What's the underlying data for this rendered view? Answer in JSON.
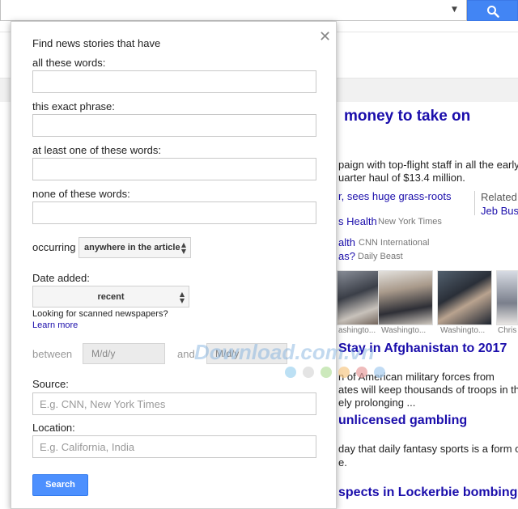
{
  "topbar": {
    "search_value": "",
    "search_icon": "search-icon",
    "dropdown_icon": "caret-down-icon",
    "accent": "#4285f4"
  },
  "panel": {
    "heading": "Find news stories that have",
    "close_icon": "close-icon",
    "all_words_label": "all these words:",
    "exact_phrase_label": "this exact phrase:",
    "at_least_one_label": "at least one of these words:",
    "none_label": "none of these words:",
    "occurring_label": "occurring",
    "occurring_value": "anywhere in the article",
    "date_added_label": "Date added:",
    "date_added_value": "recent",
    "scanned_text": "Looking for scanned newspapers?",
    "learn_more": "Learn more",
    "between_label": "between",
    "and_label": "and",
    "date_from_placeholder": "M/d/y",
    "date_to_placeholder": "M/d/y",
    "source_label": "Source:",
    "source_placeholder": "E.g. CNN, New York Times",
    "location_label": "Location:",
    "location_placeholder": "E.g. California, India",
    "search_button": "Search"
  },
  "news": {
    "headline1": "money to take on",
    "snippet1_line1": "paign with top-flight staff in all the early",
    "snippet1_line2": "uarter haul of $13.4 million.",
    "link1": "r, sees huge grass-roots",
    "related_label": "Related",
    "related_link": "Jeb Bus",
    "link2": "s Health",
    "link2_source": "New York Times",
    "link3": "alth",
    "link3_source": "CNN International",
    "link4": "as?",
    "link4_source": "Daily Beast",
    "captions": [
      "ashingto...",
      "Washingto...",
      "Washingto...",
      "Chris"
    ],
    "headline2": "Stay in Afghanistan to 2017",
    "snippet2_line1": "n of American military forces from",
    "snippet2_line2": "ates will keep thousands of troops in the",
    "snippet2_line3": "ely prolonging ...",
    "headline3": "unlicensed gambling",
    "snippet3_line1": "day that daily fantasy sports is a form of",
    "snippet3_line2": "e.",
    "headline4": "spects in Lockerbie bombing"
  },
  "watermark": {
    "text": "Download.com.vn",
    "dot_colors": [
      "#9fd3f0",
      "#d9d9d9",
      "#b6e0a0",
      "#f6c987",
      "#e8a0a0",
      "#a8cdf0"
    ]
  }
}
